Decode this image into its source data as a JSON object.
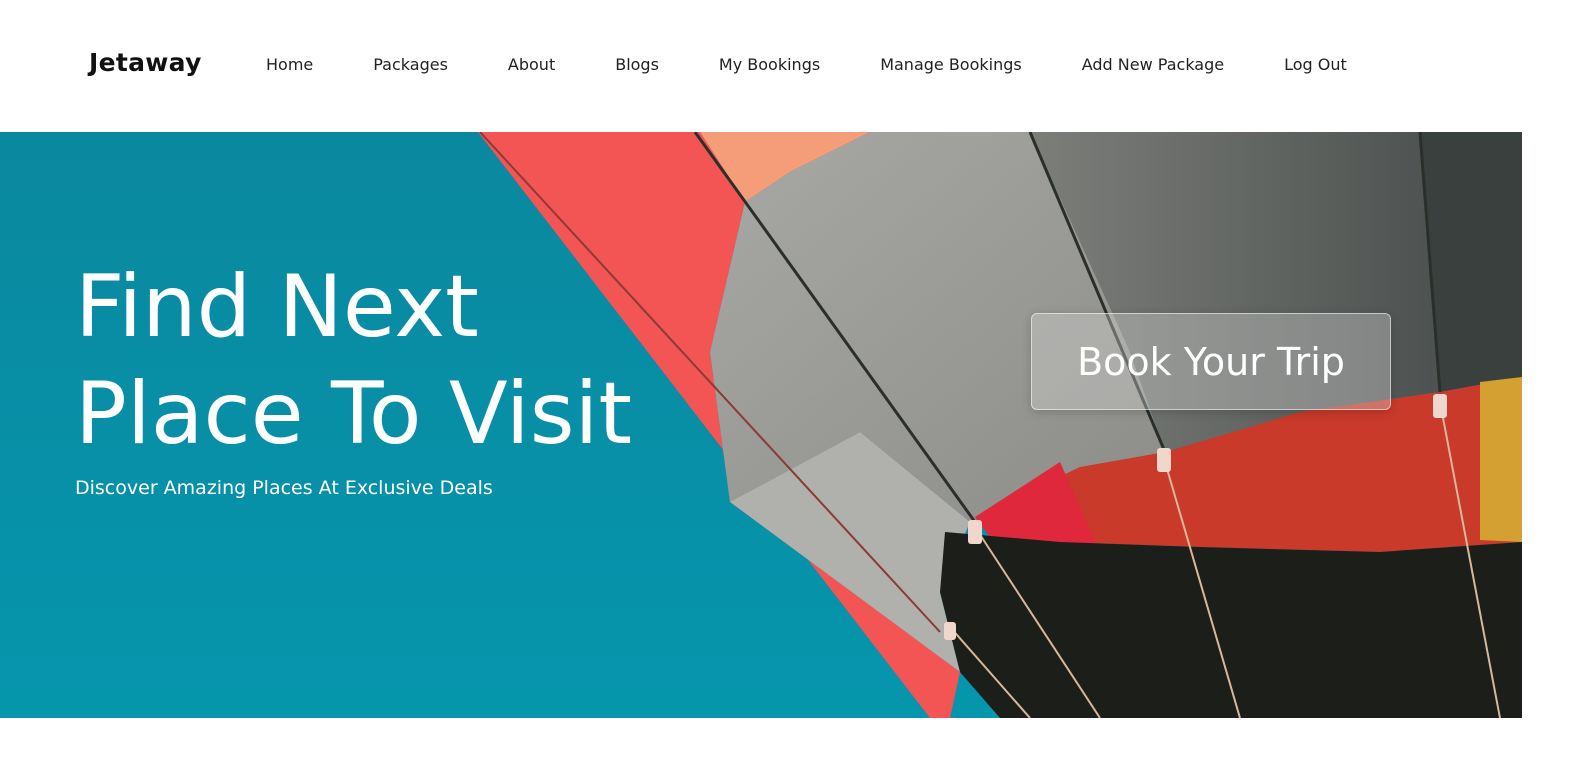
{
  "brand": {
    "name": "Jetaway"
  },
  "nav": {
    "items": [
      {
        "label": "Home"
      },
      {
        "label": "Packages"
      },
      {
        "label": "About"
      },
      {
        "label": "Blogs"
      },
      {
        "label": "My Bookings"
      },
      {
        "label": "Manage Bookings"
      },
      {
        "label": "Add New Package"
      },
      {
        "label": "Log Out"
      }
    ]
  },
  "hero": {
    "title_line1": "Find Next",
    "title_line2": "Place To Visit",
    "subtitle": "Discover Amazing Places At Exclusive Deals",
    "cta_label": "Book Your Trip",
    "background_image": "hot-air-balloon-image"
  },
  "colors": {
    "sky": "#0a8ea6",
    "balloon_red": "#f05252",
    "balloon_grey": "#9a9a96",
    "balloon_dark": "#1c1e1a",
    "text_dark": "#111111"
  }
}
